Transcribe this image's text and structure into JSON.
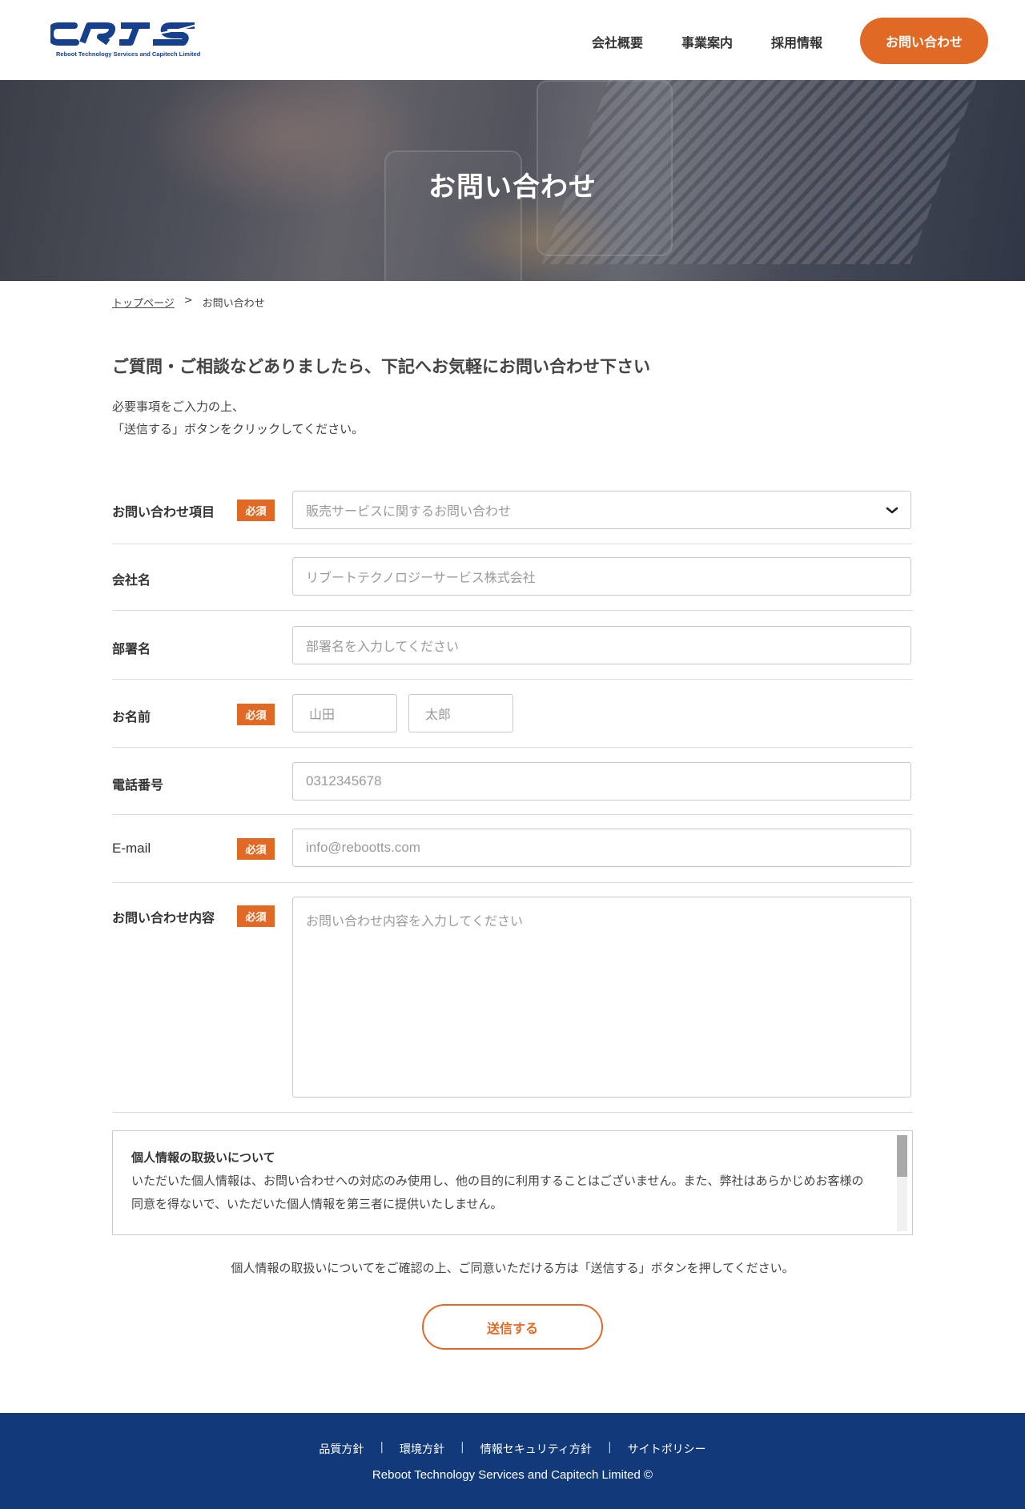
{
  "header": {
    "logo_text": "CRTS",
    "logo_subtitle": "Reboot Technology Services and Capitech Limited",
    "nav": [
      "会社概要",
      "事業案内",
      "採用情報"
    ],
    "cta": "お問い合わせ"
  },
  "hero": {
    "title": "お問い合わせ"
  },
  "breadcrumb": {
    "home": "トップページ",
    "separator": ">",
    "current": "お問い合わせ"
  },
  "intro": {
    "title": "ご質問・ご相談などありましたら、下記へお気軽にお問い合わせ下さい",
    "line1": "必要事項をご入力の上、",
    "line2": "「送信する」ボタンをクリックしてください。"
  },
  "form": {
    "required_badge": "必須",
    "inquiry_type": {
      "label": "お問い合わせ項目",
      "selected": "販売サービスに関するお問い合わせ"
    },
    "company": {
      "label": "会社名",
      "placeholder": "リブートテクノロジーサービス株式会社"
    },
    "department": {
      "label": "部署名",
      "placeholder": "部署名を入力してください"
    },
    "name": {
      "label": "お名前",
      "last_placeholder": "山田",
      "first_placeholder": "太郎"
    },
    "phone": {
      "label": "電話番号",
      "placeholder": "0312345678"
    },
    "email": {
      "label": "E-mail",
      "placeholder": "info@rebootts.com"
    },
    "message": {
      "label": "お問い合わせ内容",
      "placeholder": "お問い合わせ内容を入力してください"
    }
  },
  "privacy": {
    "title": "個人情報の取扱いについて",
    "text": "いただいた個人情報は、お問い合わせへの対応のみ使用し、他の目的に利用することはございません。また、弊社はあらかじめお客様の同意を得ないで、いただいた個人情報を第三者に提供いたしません。"
  },
  "consent": "個人情報の取扱いについてをご確認の上、ご同意いただける方は「送信する」ボタンを押してください。",
  "submit": "送信する",
  "footer": {
    "links": [
      "品質方針",
      "環境方針",
      "情報セキュリティ方針",
      "サイトポリシー"
    ],
    "separator": "|",
    "copyright": "Reboot Technology Services and Capitech Limited ©"
  },
  "colors": {
    "accent": "#e06a25",
    "brand": "#163f8c",
    "footer_bg": "#123a7a"
  }
}
